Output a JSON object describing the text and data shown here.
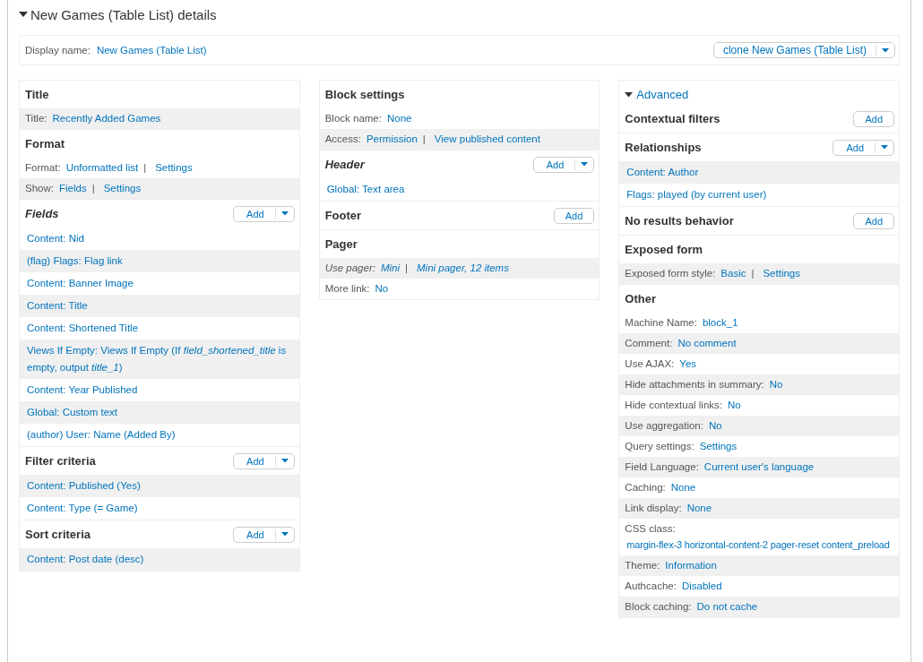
{
  "details": {
    "title": "New Games (Table List) details",
    "expanded": true
  },
  "display_name": {
    "label": "Display name:",
    "value": "New Games (Table List)",
    "clone_button": {
      "label": "clone New Games (Table List)",
      "dropdown": true
    }
  },
  "columns": [
    {
      "sections": [
        {
          "heading": "Title",
          "italic": false,
          "rows": [
            {
              "kind": "setting",
              "shaded": true,
              "label": "Title:",
              "values": [
                "Recently Added Games"
              ]
            }
          ]
        },
        {
          "heading": "Format",
          "italic": false,
          "rows": [
            {
              "kind": "setting",
              "shaded": false,
              "label": "Format:",
              "values": [
                "Unformatted list",
                "Settings"
              ],
              "separator": "|"
            },
            {
              "kind": "setting",
              "shaded": true,
              "label": "Show:",
              "values": [
                "Fields",
                "Settings"
              ],
              "separator": "|"
            }
          ]
        },
        {
          "heading": "Fields",
          "italic": true,
          "add": {
            "label": "Add",
            "dropdown": true
          },
          "rows": [
            {
              "kind": "item",
              "shaded": false,
              "text": "Content: Nid"
            },
            {
              "kind": "item",
              "shaded": true,
              "text": "(flag) Flags: Flag link"
            },
            {
              "kind": "item",
              "shaded": false,
              "text": "Content: Banner Image"
            },
            {
              "kind": "item",
              "shaded": true,
              "text": "Content: Title"
            },
            {
              "kind": "item",
              "shaded": false,
              "text": "Content: Shortened Title"
            },
            {
              "kind": "item",
              "shaded": true,
              "text": "Views If Empty: Views If Empty (If *field_shortened_title* is empty, output *title_1*)"
            },
            {
              "kind": "item",
              "shaded": false,
              "text": "Content: Year Published"
            },
            {
              "kind": "item",
              "shaded": true,
              "text": "Global: Custom text"
            },
            {
              "kind": "item",
              "shaded": false,
              "text": "(author) User: Name (Added By)"
            }
          ]
        },
        {
          "heading": "Filter criteria",
          "italic": false,
          "add": {
            "label": "Add",
            "dropdown": true
          },
          "rows": [
            {
              "kind": "item",
              "shaded": true,
              "text": "Content: Published (Yes)"
            },
            {
              "kind": "item",
              "shaded": false,
              "text": "Content: Type (= Game)"
            }
          ]
        },
        {
          "heading": "Sort criteria",
          "italic": false,
          "add": {
            "label": "Add",
            "dropdown": true
          },
          "rows": [
            {
              "kind": "item",
              "shaded": true,
              "text": "Content: Post date (desc)"
            }
          ]
        }
      ]
    },
    {
      "sections": [
        {
          "heading": "Block settings",
          "italic": false,
          "rows": [
            {
              "kind": "setting",
              "shaded": false,
              "label": "Block name:",
              "values": [
                "None"
              ]
            },
            {
              "kind": "setting",
              "shaded": true,
              "label": "Access:",
              "values": [
                "Permission",
                "View published content"
              ],
              "separator": "|"
            }
          ]
        },
        {
          "heading": "Header",
          "italic": true,
          "add": {
            "label": "Add",
            "dropdown": true
          },
          "rows": [
            {
              "kind": "item",
              "shaded": false,
              "text": "Global: Text area"
            }
          ]
        },
        {
          "heading": "Footer",
          "italic": false,
          "add": {
            "label": "Add",
            "dropdown": false
          }
        },
        {
          "heading": "Pager",
          "italic": false,
          "rows": [
            {
              "kind": "setting",
              "shaded": true,
              "italic": true,
              "label": "Use pager:",
              "values": [
                "Mini",
                "Mini pager, 12 items"
              ],
              "separator": "|"
            },
            {
              "kind": "setting",
              "shaded": false,
              "label": "More link:",
              "values": [
                "No"
              ]
            }
          ]
        }
      ]
    },
    {
      "advanced": {
        "label": "Advanced",
        "expanded": true
      },
      "sections": [
        {
          "heading": "Contextual filters",
          "italic": false,
          "add": {
            "label": "Add",
            "dropdown": false
          }
        },
        {
          "heading": "Relationships",
          "italic": false,
          "add": {
            "label": "Add",
            "dropdown": true
          },
          "rows": [
            {
              "kind": "item",
              "shaded": true,
              "text": "Content: Author"
            },
            {
              "kind": "item",
              "shaded": false,
              "text": "Flags: played (by current user)"
            }
          ]
        },
        {
          "heading": "No results behavior",
          "italic": false,
          "add": {
            "label": "Add",
            "dropdown": false
          }
        },
        {
          "heading": "Exposed form",
          "italic": false,
          "rows": [
            {
              "kind": "setting",
              "shaded": true,
              "label": "Exposed form style:",
              "values": [
                "Basic",
                "Settings"
              ],
              "separator": "|"
            }
          ]
        },
        {
          "heading": "Other",
          "italic": false,
          "rows": [
            {
              "kind": "setting",
              "shaded": false,
              "label": "Machine Name:",
              "values": [
                "block_1"
              ]
            },
            {
              "kind": "setting",
              "shaded": true,
              "label": "Comment:",
              "values": [
                "No comment"
              ]
            },
            {
              "kind": "setting",
              "shaded": false,
              "label": "Use AJAX:",
              "values": [
                "Yes"
              ]
            },
            {
              "kind": "setting",
              "shaded": true,
              "label": "Hide attachments in summary:",
              "values": [
                "No"
              ]
            },
            {
              "kind": "setting",
              "shaded": false,
              "label": "Hide contextual links:",
              "values": [
                "No"
              ]
            },
            {
              "kind": "setting",
              "shaded": true,
              "label": "Use aggregation:",
              "values": [
                "No"
              ]
            },
            {
              "kind": "setting",
              "shaded": false,
              "label": "Query settings:",
              "values": [
                "Settings"
              ]
            },
            {
              "kind": "setting",
              "shaded": true,
              "label": "Field Language:",
              "values": [
                "Current user's language"
              ]
            },
            {
              "kind": "setting",
              "shaded": false,
              "label": "Caching:",
              "values": [
                "None"
              ]
            },
            {
              "kind": "setting",
              "shaded": true,
              "label": "Link display:",
              "values": [
                "None"
              ]
            },
            {
              "kind": "block",
              "shaded": false,
              "label": "CSS class:",
              "values": [
                "margin-flex-3 horizontal-content-2 pager-reset content_preload"
              ]
            },
            {
              "kind": "setting",
              "shaded": true,
              "label": "Theme:",
              "values": [
                "Information"
              ]
            },
            {
              "kind": "setting",
              "shaded": false,
              "label": "Authcache:",
              "values": [
                "Disabled"
              ]
            },
            {
              "kind": "setting",
              "shaded": true,
              "label": "Block caching:",
              "values": [
                "Do not cache"
              ]
            }
          ]
        }
      ]
    }
  ]
}
